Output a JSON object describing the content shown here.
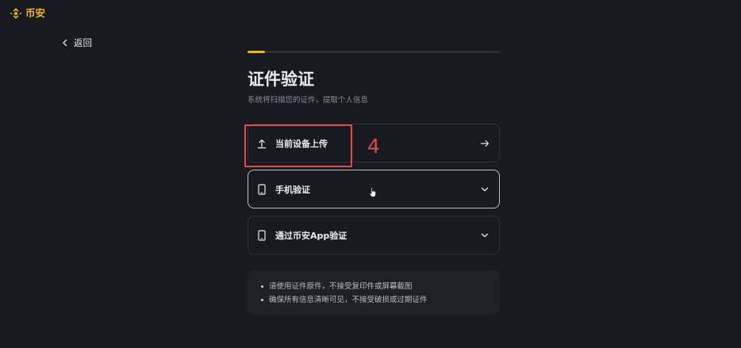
{
  "brand": {
    "name": "币安",
    "accent": "#f0b90b",
    "logo_icon": "binance-logo-icon"
  },
  "nav": {
    "back_label": "返回",
    "back_icon": "chevron-left-icon"
  },
  "progress": {
    "fraction": 0.07
  },
  "header": {
    "title": "证件验证",
    "subtitle": "系统将扫描您的证件，提取个人信息"
  },
  "options": [
    {
      "label": "当前设备上传",
      "icon": "upload-icon",
      "trailing_icon": "arrow-right-icon"
    },
    {
      "label": "手机验证",
      "icon": "phone-icon",
      "trailing_icon": "chevron-down-icon"
    },
    {
      "label": "通过币安App验证",
      "icon": "phone-icon",
      "trailing_icon": "chevron-down-icon"
    }
  ],
  "annotation": {
    "number": "4",
    "color": "#e24a4a"
  },
  "notice": {
    "items": [
      "请使用证件原件，不接受复印件或屏幕截图",
      "确保所有信息清晰可见，不接受破损或过期证件"
    ]
  }
}
